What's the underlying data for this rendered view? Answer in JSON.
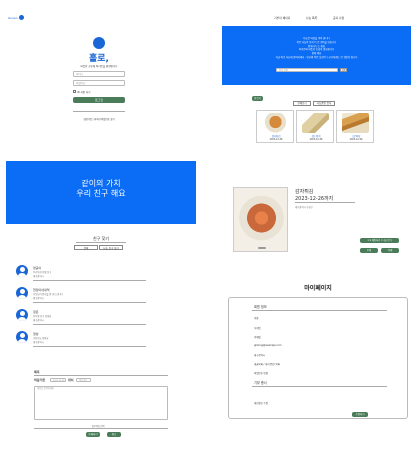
{
  "header": {
    "brand": "Grown",
    "nav": [
      "기부자 페이지",
      "나눔 목록",
      "공지 사항"
    ]
  },
  "login": {
    "title": "홀로,",
    "subtitle": "따뜻한 공유에 여러분을 환영합니다",
    "id_placeholder": "아이디",
    "pw_placeholder": "비밀번호",
    "remember": "ID 저장 하기",
    "login_button": "로그인",
    "links": "회원가입 | 아이디/비밀번호 찾기"
  },
  "banner": {
    "lines": [
      "나눔은 마음을 이어 줍니다",
      "작은 나눔이 모여 더 큰 행복을 만듭니다",
      "함께 나누는 세상",
      "여러분의 따뜻한 손길이 필요합니다",
      "함께 해요",
      "지금 바로 나눔에 참여하세요 - 당신의 작은 실천이 누군가에게는 큰 희망이 됩니다"
    ],
    "search_placeholder": "음식 검색",
    "search_button": "검색",
    "write_button": "글쓰기",
    "tabs": [
      "전체보기",
      "나눔중인 음식"
    ]
  },
  "products": [
    {
      "name": "감자튀김",
      "date": "2023-12-26",
      "color": "#c98a3a"
    },
    {
      "name": "샌드위치",
      "date": "2023-12-26",
      "color": "#d8c49a"
    },
    {
      "name": "크로와상",
      "date": "2023-12-26",
      "color": "#d49a4e"
    }
  ],
  "friends_banner": {
    "line1": "같이의 가치",
    "line2": "우리 친구 해요",
    "heading": "친구 찾기",
    "tabs": [
      "전체",
      "나눔 친구 찾기"
    ]
  },
  "friends": [
    {
      "name": "영공이",
      "line1": "우리동네 학생 친구",
      "line2": "대구광역시"
    },
    {
      "name": "현정이네새댁",
      "line1": "부모님이 음식을 잘 만드십니다",
      "line2": "대구광역시"
    },
    {
      "name": "정은",
      "line1": "유학생 친구 찾아요",
      "line2": "대구광역시"
    },
    {
      "name": "형성",
      "line1": "공유나눔 좋아요",
      "line2": "대구광역시"
    }
  ],
  "write_form": {
    "title_label": "제목",
    "deadline_label": "마감기한",
    "deadline_value": "2023.12.26",
    "location_label": "위치",
    "location_value": "대구 동구",
    "content_placeholder": "내용을 입력하세요",
    "attach": "첨부파일 선택",
    "submit": "등록하기",
    "cancel": "취소"
  },
  "detail": {
    "title": "감자튀김",
    "date": "2023-12-26까지",
    "location": "대구광역시 수성구",
    "chat_button": "1:1 채팅하기 / 나눔 받기",
    "edit_button": "수정",
    "delete_button": "삭제",
    "food_color": "#c9683a"
  },
  "mypage": {
    "title": "마이페이지",
    "section1": "회원 정보",
    "name_label": "이름",
    "nickname_label": "닉네임",
    "email_label": "이메일",
    "email": "gildong@example.com",
    "location": "대구광역시",
    "item1": "내글목록 / 내가 찜한 목록",
    "item2": "비밀번호 변경",
    "section2": "기부 증서",
    "item3": "개인정보 수정",
    "edit_button": "수정하기"
  }
}
